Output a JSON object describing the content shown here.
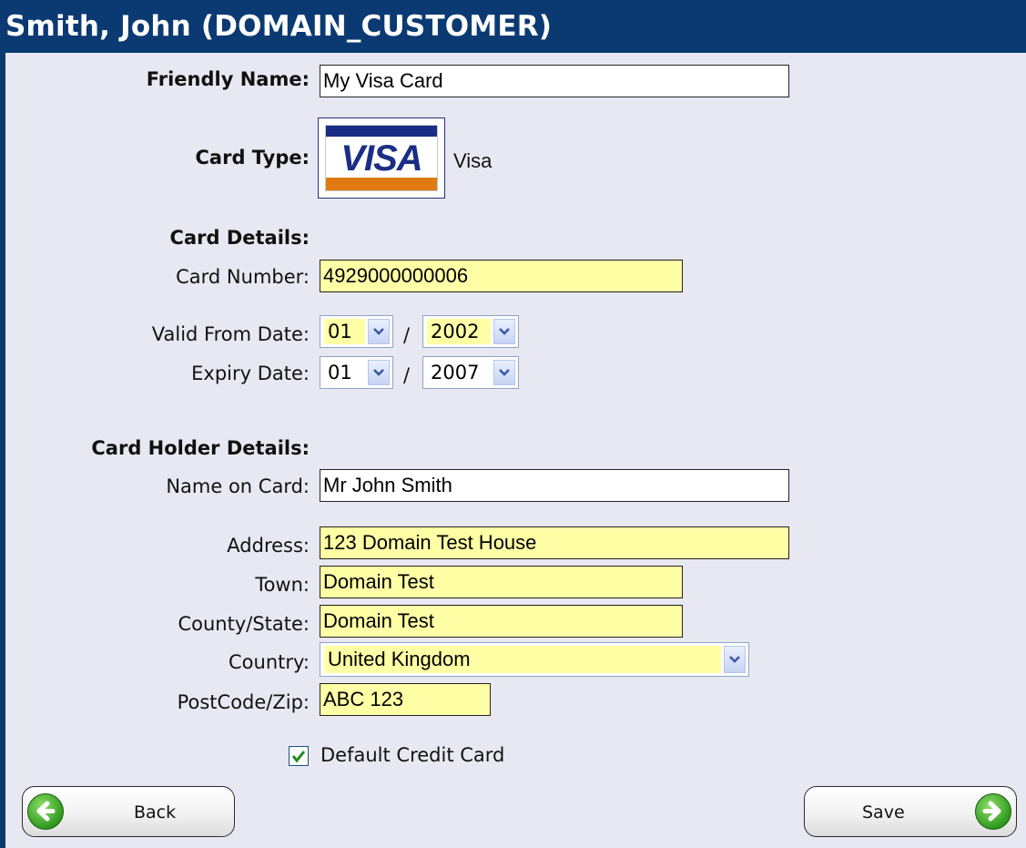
{
  "window": {
    "title": "Smith, John (DOMAIN_CUSTOMER)"
  },
  "friendly_name": {
    "label": "Friendly Name:",
    "value": "My Visa Card"
  },
  "card_type": {
    "label": "Card Type:",
    "logo_text": "VISA",
    "name": "Visa",
    "logo_icon": "visa-logo-icon"
  },
  "card_details": {
    "heading": "Card Details:",
    "card_number_label": "Card Number:",
    "card_number": "4929000000006",
    "valid_from_label": "Valid From Date:",
    "valid_from_month": "01",
    "valid_from_year": "2002",
    "expiry_label": "Expiry Date:",
    "expiry_month": "01",
    "expiry_year": "2007",
    "date_separator": "/"
  },
  "card_holder": {
    "heading": "Card Holder Details:",
    "name_label": "Name on Card:",
    "name": "Mr John Smith",
    "address_label": "Address:",
    "address": "123 Domain Test House",
    "town_label": "Town:",
    "town": "Domain Test",
    "county_label": "County/State:",
    "county": "Domain Test",
    "country_label": "Country:",
    "country": "United Kingdom",
    "postcode_label": "PostCode/Zip:",
    "postcode": "ABC 123"
  },
  "default_card": {
    "label": "Default Credit Card",
    "checked": true
  },
  "buttons": {
    "back": "Back",
    "save": "Save"
  },
  "colors": {
    "title_bar": "#0b3a72",
    "required_field": "#ffffa6",
    "background": "#e8e8f2",
    "button_icon": "#3aa524"
  }
}
